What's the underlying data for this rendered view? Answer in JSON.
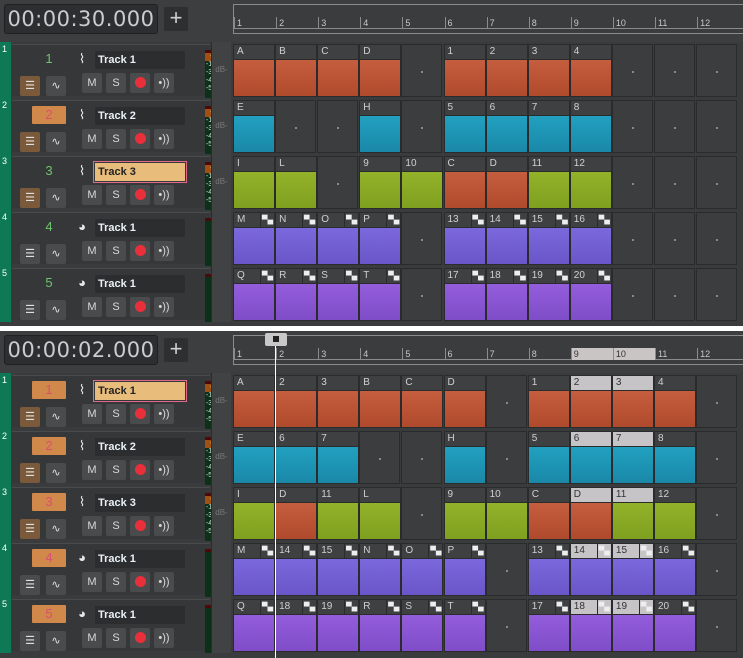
{
  "panels": [
    {
      "time": "00:00:30.000",
      "add_label": "+",
      "ruler": [
        "1",
        "2",
        "3",
        "4",
        "5",
        "6",
        "7",
        "8",
        "9",
        "10",
        "11",
        "12"
      ],
      "ruler_selected": [],
      "tracks": [
        {
          "index": "1",
          "number": "1",
          "number_style": "plain",
          "type_icon": "waveform-icon",
          "name": "Track 1",
          "highlight": false,
          "meter": [
            "-6",
            "-18",
            "-30",
            "-42",
            "-54"
          ],
          "db": "dB-",
          "mute": "M",
          "solo": "S",
          "clips": [
            {
              "l": "A",
              "c": "orange"
            },
            {
              "l": "B",
              "c": "orange"
            },
            {
              "l": "C",
              "c": "orange"
            },
            {
              "l": "D",
              "c": "orange"
            },
            null,
            {
              "l": "1",
              "c": "orange"
            },
            {
              "l": "2",
              "c": "orange"
            },
            {
              "l": "3",
              "c": "orange"
            },
            {
              "l": "4",
              "c": "orange"
            }
          ]
        },
        {
          "index": "2",
          "number": "2",
          "number_style": "orange",
          "type_icon": "waveform-icon",
          "name": "Track 2",
          "highlight": false,
          "meter": [
            "-6",
            "-18",
            "-30",
            "-42",
            "-54"
          ],
          "db": "dB-",
          "mute": "M",
          "solo": "S",
          "clips": [
            {
              "l": "E",
              "c": "blue"
            },
            null,
            null,
            {
              "l": "H",
              "c": "blue"
            },
            null,
            {
              "l": "5",
              "c": "blue"
            },
            {
              "l": "6",
              "c": "blue"
            },
            {
              "l": "7",
              "c": "blue"
            },
            {
              "l": "8",
              "c": "blue"
            }
          ]
        },
        {
          "index": "3",
          "number": "3",
          "number_style": "plain",
          "type_icon": "waveform-icon",
          "name": "Track 3",
          "highlight": true,
          "meter": [
            "-6",
            "-18",
            "-30",
            "-42",
            "-54"
          ],
          "db": "dB-",
          "mute": "M",
          "solo": "S",
          "clips": [
            {
              "l": "I",
              "c": "green"
            },
            {
              "l": "L",
              "c": "green"
            },
            null,
            {
              "l": "9",
              "c": "green"
            },
            {
              "l": "10",
              "c": "green"
            },
            {
              "l": "C",
              "c": "orange"
            },
            {
              "l": "D",
              "c": "orange"
            },
            {
              "l": "11",
              "c": "green"
            },
            {
              "l": "12",
              "c": "green"
            }
          ]
        },
        {
          "index": "4",
          "number": "4",
          "number_style": "plain",
          "type_icon": "midi-icon",
          "name": "Track 1",
          "highlight": false,
          "meter": [],
          "db": "",
          "mute": "M",
          "solo": "S",
          "clips": [
            {
              "l": "M",
              "c": "purple1",
              "midi": true
            },
            {
              "l": "N",
              "c": "purple1",
              "midi": true
            },
            {
              "l": "O",
              "c": "purple1",
              "midi": true
            },
            {
              "l": "P",
              "c": "purple1",
              "midi": true
            },
            null,
            {
              "l": "13",
              "c": "purple1",
              "midi": true
            },
            {
              "l": "14",
              "c": "purple1",
              "midi": true
            },
            {
              "l": "15",
              "c": "purple1",
              "midi": true
            },
            {
              "l": "16",
              "c": "purple1",
              "midi": true
            }
          ]
        },
        {
          "index": "5",
          "number": "5",
          "number_style": "plain",
          "type_icon": "midi-icon",
          "name": "Track 1",
          "highlight": false,
          "meter": [],
          "db": "",
          "mute": "M",
          "solo": "S",
          "clips": [
            {
              "l": "Q",
              "c": "purple2",
              "midi": true
            },
            {
              "l": "R",
              "c": "purple2",
              "midi": true
            },
            {
              "l": "S",
              "c": "purple2",
              "midi": true
            },
            {
              "l": "T",
              "c": "purple2",
              "midi": true
            },
            null,
            {
              "l": "17",
              "c": "purple2",
              "midi": true
            },
            {
              "l": "18",
              "c": "purple2",
              "midi": true
            },
            {
              "l": "19",
              "c": "purple2",
              "midi": true
            },
            {
              "l": "20",
              "c": "purple2",
              "midi": true
            }
          ]
        }
      ]
    },
    {
      "time": "00:00:02.000",
      "add_label": "+",
      "ruler": [
        "1",
        "2",
        "3",
        "4",
        "5",
        "6",
        "7",
        "8",
        "9",
        "10",
        "11",
        "12"
      ],
      "ruler_selected": [
        "9",
        "10"
      ],
      "tracks": [
        {
          "index": "1",
          "number": "1",
          "number_style": "orange",
          "type_icon": "waveform-icon",
          "name": "Track 1",
          "highlight": true,
          "meter": [
            "-6",
            "-18",
            "-30",
            "-42",
            "-54"
          ],
          "db": "dB-",
          "mute": "M",
          "solo": "S",
          "clips": [
            {
              "l": "A",
              "c": "orange"
            },
            {
              "l": "2",
              "c": "orange"
            },
            {
              "l": "3",
              "c": "orange"
            },
            {
              "l": "B",
              "c": "orange"
            },
            {
              "l": "C",
              "c": "orange"
            },
            {
              "l": "D",
              "c": "orange"
            },
            null,
            {
              "l": "1",
              "c": "orange"
            },
            {
              "l": "2",
              "c": "orange",
              "sel": true
            },
            {
              "l": "3",
              "c": "orange",
              "sel": true
            },
            {
              "l": "4",
              "c": "orange"
            }
          ]
        },
        {
          "index": "2",
          "number": "2",
          "number_style": "orange",
          "type_icon": "waveform-icon",
          "name": "Track 2",
          "highlight": false,
          "meter": [
            "-6",
            "-18",
            "-30",
            "-42",
            "-54"
          ],
          "db": "dB-",
          "mute": "M",
          "solo": "S",
          "clips": [
            {
              "l": "E",
              "c": "blue"
            },
            {
              "l": "6",
              "c": "blue"
            },
            {
              "l": "7",
              "c": "blue"
            },
            null,
            null,
            {
              "l": "H",
              "c": "blue"
            },
            null,
            {
              "l": "5",
              "c": "blue"
            },
            {
              "l": "6",
              "c": "blue",
              "sel": true
            },
            {
              "l": "7",
              "c": "blue",
              "sel": true
            },
            {
              "l": "8",
              "c": "blue"
            }
          ]
        },
        {
          "index": "3",
          "number": "3",
          "number_style": "orange",
          "type_icon": "waveform-icon",
          "name": "Track 3",
          "highlight": false,
          "meter": [
            "-6",
            "-18",
            "-30",
            "-42",
            "-54"
          ],
          "db": "dB-",
          "mute": "M",
          "solo": "S",
          "clips": [
            {
              "l": "I",
              "c": "green"
            },
            {
              "l": "D",
              "c": "orange"
            },
            {
              "l": "11",
              "c": "green"
            },
            {
              "l": "L",
              "c": "green"
            },
            null,
            {
              "l": "9",
              "c": "green"
            },
            {
              "l": "10",
              "c": "green"
            },
            {
              "l": "C",
              "c": "orange"
            },
            {
              "l": "D",
              "c": "orange",
              "sel": true
            },
            {
              "l": "11",
              "c": "green",
              "sel": true
            },
            {
              "l": "12",
              "c": "green"
            }
          ]
        },
        {
          "index": "4",
          "number": "4",
          "number_style": "orange",
          "type_icon": "midi-icon",
          "name": "Track 1",
          "highlight": false,
          "meter": [],
          "db": "",
          "mute": "M",
          "solo": "S",
          "clips": [
            {
              "l": "M",
              "c": "purple1",
              "midi": true
            },
            {
              "l": "14",
              "c": "purple1",
              "midi": true
            },
            {
              "l": "15",
              "c": "purple1",
              "midi": true
            },
            {
              "l": "N",
              "c": "purple1",
              "midi": true
            },
            {
              "l": "O",
              "c": "purple1",
              "midi": true
            },
            {
              "l": "P",
              "c": "purple1",
              "midi": true
            },
            null,
            {
              "l": "13",
              "c": "purple1",
              "midi": true
            },
            {
              "l": "14",
              "c": "purple1",
              "midi": true,
              "sel": true
            },
            {
              "l": "15",
              "c": "purple1",
              "midi": true,
              "sel": true
            },
            {
              "l": "16",
              "c": "purple1",
              "midi": true
            }
          ]
        },
        {
          "index": "5",
          "number": "5",
          "number_style": "orange",
          "type_icon": "midi-icon",
          "name": "Track 1",
          "highlight": false,
          "meter": [],
          "db": "",
          "mute": "M",
          "solo": "S",
          "clips": [
            {
              "l": "Q",
              "c": "purple2",
              "midi": true
            },
            {
              "l": "18",
              "c": "purple2",
              "midi": true
            },
            {
              "l": "19",
              "c": "purple2",
              "midi": true
            },
            {
              "l": "R",
              "c": "purple2",
              "midi": true
            },
            {
              "l": "S",
              "c": "purple2",
              "midi": true
            },
            {
              "l": "T",
              "c": "purple2",
              "midi": true
            },
            null,
            {
              "l": "17",
              "c": "purple2",
              "midi": true
            },
            {
              "l": "18",
              "c": "purple2",
              "midi": true,
              "sel": true
            },
            {
              "l": "19",
              "c": "purple2",
              "midi": true,
              "sel": true
            },
            {
              "l": "20",
              "c": "purple2",
              "midi": true
            }
          ]
        }
      ]
    }
  ]
}
